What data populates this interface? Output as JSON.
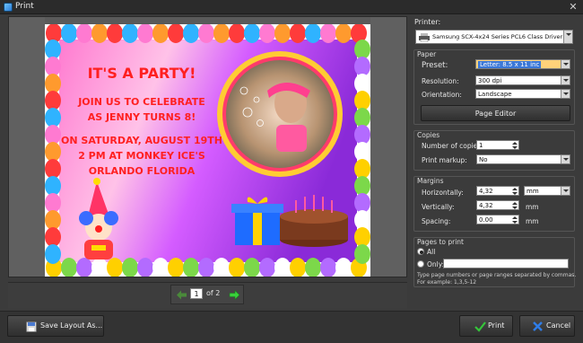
{
  "window": {
    "title": "Print",
    "close_icon": "close-icon"
  },
  "preview": {
    "card": {
      "headline": "IT'S A PARTY!",
      "line1": "JOIN US TO CELEBRATE",
      "line2": "AS JENNY TURNS 8!",
      "line3": "ON SATURDAY, AUGUST 19TH",
      "line4": "2 PM AT MONKEY ICE'S",
      "line5": "ORLANDO FLORIDA"
    },
    "pager": {
      "current": "1",
      "of_label": "of 2"
    }
  },
  "printer": {
    "label": "Printer:",
    "value": "Samsung SCX-4x24 Series PCL6 Class Driver"
  },
  "paper": {
    "section": "Paper",
    "preset_label": "Preset:",
    "preset_value": "Letter: 8.5 x 11 inc",
    "resolution_label": "Resolution:",
    "resolution_value": "300 dpi",
    "orientation_label": "Orientation:",
    "orientation_value": "Landscape",
    "page_editor_button": "Page Editor"
  },
  "copies": {
    "section": "Copies",
    "number_label": "Number of copies:",
    "number_value": "1",
    "markup_label": "Print markup:",
    "markup_value": "No"
  },
  "margins": {
    "section": "Margins",
    "horizontal_label": "Horizontally:",
    "horizontal_value": "4,32",
    "unit_value": "mm",
    "vertical_label": "Vertically:",
    "vertical_value": "4,32",
    "vertical_unit": "mm",
    "spacing_label": "Spacing:",
    "spacing_value": "0.00",
    "spacing_unit": "mm"
  },
  "pages": {
    "section": "Pages to print",
    "all_label": "All",
    "only_label": "Only:",
    "only_value": "",
    "hint1": "Type page numbers or page ranges separated by commas.",
    "hint2": "For example: 1,3,5-12"
  },
  "footer": {
    "save_layout": "Save Layout As...",
    "print": "Print",
    "cancel": "Cancel"
  },
  "colors": {
    "accent_selection": "#3b78d8",
    "preset_highlight": "#ffd27a"
  }
}
